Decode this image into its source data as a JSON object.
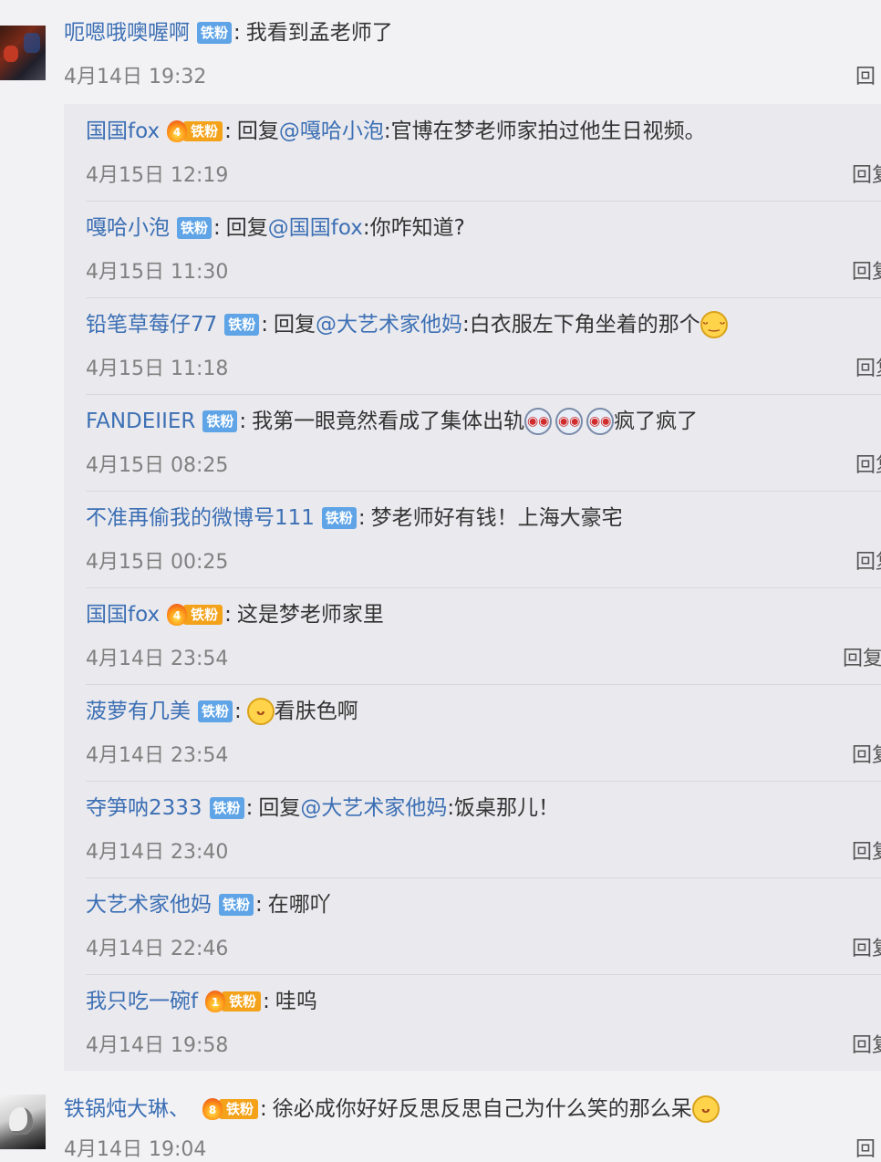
{
  "top_comment": {
    "user": "呃嗯哦噢喔啊",
    "badge": "铁粉",
    "text": "我看到孟老师了",
    "time": "4月14日 19:32",
    "reply_label": "回"
  },
  "replies": [
    {
      "user": "国国fox",
      "badge": "铁粉",
      "badge_style": "fire",
      "badge_level": "4",
      "prefix": "回复",
      "mention": "@嘎哈小泡",
      "text": ":官博在梦老师家拍过他生日视频。",
      "emoji": "",
      "time": "4月15日 12:19",
      "reply_label": "回复"
    },
    {
      "user": "嘎哈小泡",
      "badge": "铁粉",
      "badge_style": "plain",
      "prefix": "回复",
      "mention": "@国国fox",
      "text": ":你咋知道?",
      "emoji": "",
      "time": "4月15日 11:30",
      "reply_label": "回复"
    },
    {
      "user": "铅笔草莓仔77",
      "badge": "铁粉",
      "badge_style": "plain",
      "prefix": "回复",
      "mention": "@大艺术家他妈",
      "text": ":白衣服左下角坐着的那个",
      "emoji": "smirk",
      "time": "4月15日 11:18",
      "reply_label": "回复"
    },
    {
      "user": "FANDEIIER",
      "badge": "铁粉",
      "badge_style": "plain",
      "prefix": "",
      "mention": "",
      "text": "我第一眼竟然看成了集体出轨",
      "emoji": "shock x3",
      "text_after": "疯了疯了",
      "time": "4月15日 08:25",
      "reply_label": "回复"
    },
    {
      "user": "不准再偷我的微博号111",
      "badge": "铁粉",
      "badge_style": "plain",
      "prefix": "",
      "mention": "",
      "text": "梦老师好有钱！上海大豪宅",
      "emoji": "",
      "time": "4月15日 00:25",
      "reply_label": "回复"
    },
    {
      "user": "国国fox",
      "badge": "铁粉",
      "badge_style": "fire",
      "badge_level": "4",
      "prefix": "",
      "mention": "",
      "text": "这是梦老师家里",
      "emoji": "",
      "time": "4月14日 23:54",
      "reply_label": "回复"
    },
    {
      "user": "菠萝有几美",
      "badge": "铁粉",
      "badge_style": "plain",
      "prefix": "",
      "mention": "",
      "text": "看肤色啊",
      "emoji": "cat",
      "time": "4月14日 23:54",
      "reply_label": "回复"
    },
    {
      "user": "夺笋呐2333",
      "badge": "铁粉",
      "badge_style": "plain",
      "prefix": "回复",
      "mention": "@大艺术家他妈",
      "text": ":饭桌那儿！",
      "emoji": "",
      "time": "4月14日 23:40",
      "reply_label": "回复"
    },
    {
      "user": "大艺术家他妈",
      "badge": "铁粉",
      "badge_style": "plain",
      "prefix": "",
      "mention": "",
      "text": "在哪吖",
      "emoji": "",
      "time": "4月14日 22:46",
      "reply_label": "回复"
    },
    {
      "user": "我只吃一碗f",
      "badge": "铁粉",
      "badge_style": "fire",
      "badge_level": "1",
      "prefix": "",
      "mention": "",
      "text": "哇呜",
      "emoji": "",
      "time": "4月14日 19:58",
      "reply_label": "回复"
    }
  ],
  "bottom_comment": {
    "user": "铁锅炖大琳、",
    "badge": "铁粉",
    "badge_level": "8",
    "text": "徐必成你好好反思反思自己为什么笑的那么呆",
    "emoji": "cat",
    "time": "4月14日 19:04",
    "reply_label": "回"
  },
  "colors": {
    "link": "#3c6fb4",
    "badge": "#5fa4e6",
    "fire_badge": "#f3a21a",
    "time": "#808080",
    "panel": "#eaeaee",
    "page": "#f2f2f5"
  }
}
